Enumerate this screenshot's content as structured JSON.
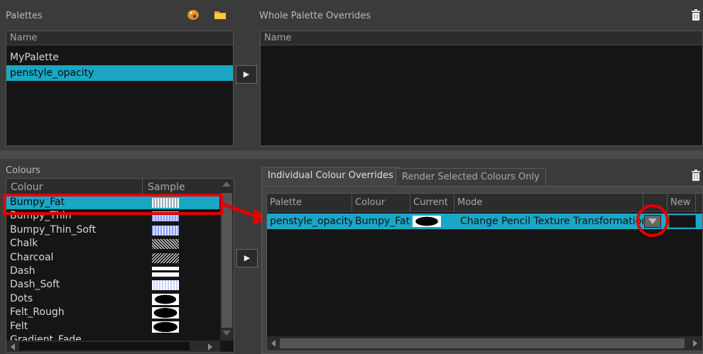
{
  "palettes": {
    "title": "Palettes",
    "column": "Name",
    "items": [
      "MyPalette",
      "penstyle_opacity"
    ]
  },
  "whole_overrides": {
    "title": "Whole Palette Overrides",
    "column": "Name"
  },
  "colours": {
    "title": "Colours",
    "columns": [
      "Colour",
      "Sample"
    ],
    "items": [
      "Bumpy_Fat",
      "Bumpy_Thin",
      "Bumpy_Thin_Soft",
      "Chalk",
      "Charcoal",
      "Dash",
      "Dash_Soft",
      "Dots",
      "Felt_Rough",
      "Felt",
      "Gradient_Fade"
    ]
  },
  "tabs": [
    "Individual Colour Overrides",
    "Render Selected Colours Only"
  ],
  "overrides_table": {
    "columns": [
      "Palette",
      "Colour",
      "Current",
      "Mode",
      "",
      "New"
    ],
    "row": {
      "palette": "penstyle_opacity",
      "colour": "Bumpy_Fat",
      "mode": "Change Pencil Texture Transformation"
    }
  },
  "colors": {
    "selection": "#1aa7c6",
    "panel": "#3b3b3b",
    "list_bg": "#151515",
    "annotation": "#e00000"
  }
}
